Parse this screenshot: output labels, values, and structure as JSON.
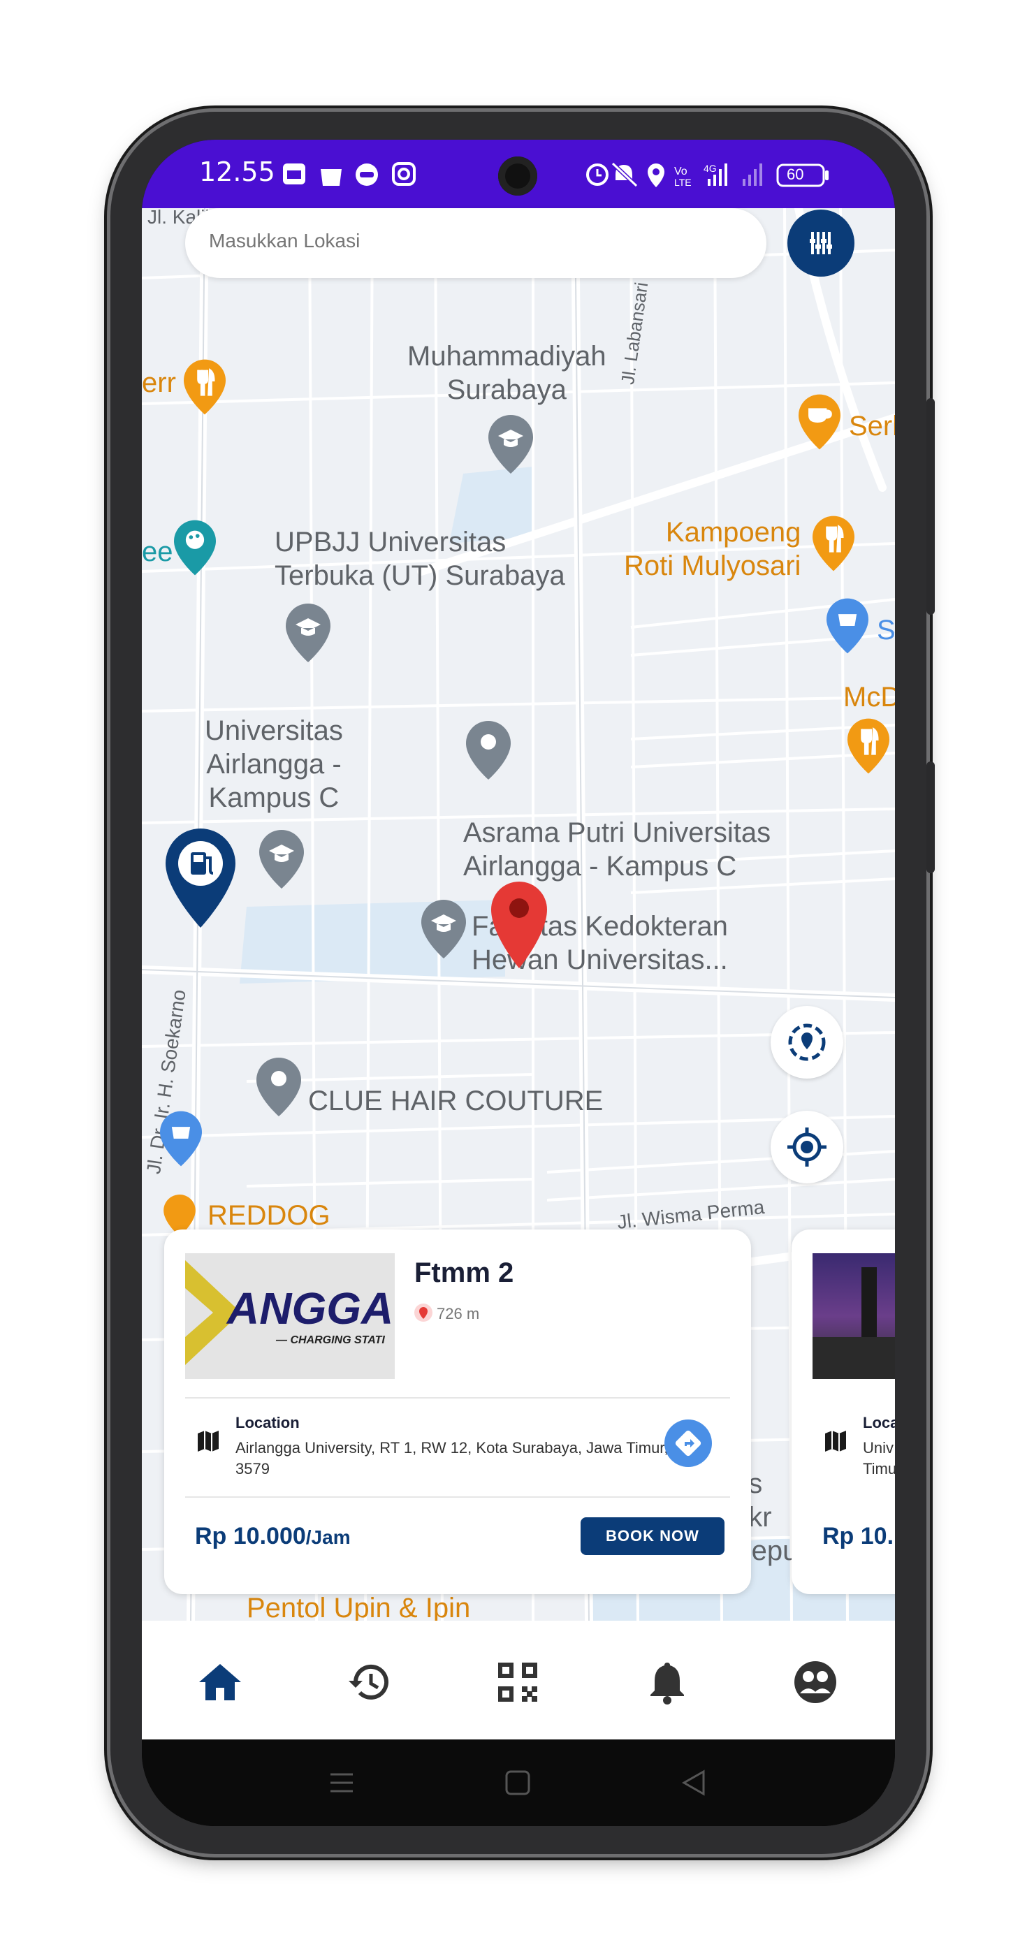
{
  "status_bar": {
    "time": "12.55",
    "battery": "60",
    "icons_left": [
      "calendar-icon",
      "shopping-bag-icon",
      "chat-icon",
      "instagram-icon"
    ],
    "icons_right": [
      "alarm-icon",
      "mute-icon",
      "location-icon",
      "volte-icon",
      "signal-4g-icon",
      "signal-icon",
      "battery-icon"
    ]
  },
  "search": {
    "placeholder": "Masukkan Lokasi"
  },
  "map": {
    "street_labels": {
      "kalijudan": "Jl. Kalijudan",
      "labansari": "Jl. Labansari",
      "soekarno": "Jl. Dr. Ir. H. Soekarno",
      "wisma_permai": "Jl. Wisma Perma"
    },
    "places": {
      "muhammadiyah": "Muhammadiyah\nSurabaya",
      "upbjj": "UPBJJ Universitas\nTerbuka (UT) Surabaya",
      "airlangga": "Universitas\nAirlangga -\nKampus C",
      "asrama": "Asrama Putri Universitas\nAirlangga - Kampus C",
      "fkh": "Fakultas Kedokteran\nHewan Universitas...",
      "clue": "CLUE HAIR COUTURE",
      "kampoeng": "Kampoeng\nRoti Mulyosari",
      "reddog": "REDDOG",
      "pentol": "Pentol Upin & Ipin",
      "err": "err",
      "ee": "ee",
      "serl": "Serl",
      "s": "S",
      "mcd": "McD",
      "bottom_right": "ns\nekr\nSepulan"
    }
  },
  "colors": {
    "status_bar": "#4a0fd2",
    "primary": "#0b3c78",
    "accent_blue": "#4a8fe6",
    "pin_red": "#e53935",
    "poi_orange": "#f29a13",
    "poi_gray": "#7a8590"
  },
  "station_card": {
    "logo_text": "ANGGA",
    "logo_subtext": "— CHARGING STATI",
    "name": "Ftmm 2",
    "distance": "726 m",
    "location_label": "Location",
    "address": "Airlangga University, RT 1, RW 12, Kota Surabaya, Jawa Timur, 3579",
    "price": "Rp 10.000",
    "price_unit": "/Jam",
    "book_label": "BOOK NOW"
  },
  "station_card_2": {
    "location_label": "Loca",
    "address_partial": "Univ\nTimu",
    "price_partial": "Rp 10."
  },
  "bottom_nav": {
    "items": [
      "home-icon",
      "history-icon",
      "qr-code-icon",
      "bell-icon",
      "profile-icon"
    ],
    "active": "home-icon"
  }
}
